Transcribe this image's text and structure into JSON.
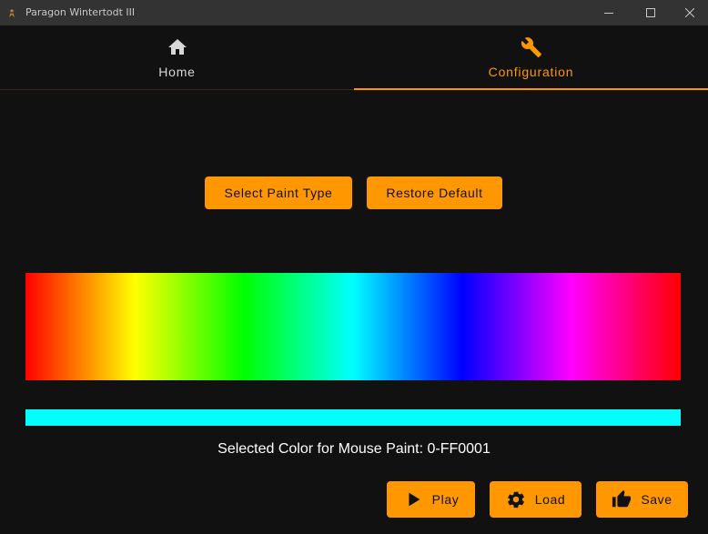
{
  "window": {
    "title": "Paragon Wintertodt III"
  },
  "tabs": [
    {
      "label": "Home",
      "icon": "home-icon",
      "active": false
    },
    {
      "label": "Configuration",
      "icon": "wrench-icon",
      "active": true
    }
  ],
  "config": {
    "select_paint_label": "Select Paint Type",
    "restore_default_label": "Restore Default",
    "selected_color_text": "Selected Color for Mouse Paint: 0-FF0001",
    "selected_color_hex": "#00FFFF"
  },
  "actions": {
    "play_label": "Play",
    "load_label": "Load",
    "save_label": "Save"
  },
  "colors": {
    "accent": "#FF9800",
    "background": "#111111",
    "titlebar": "#333333"
  }
}
